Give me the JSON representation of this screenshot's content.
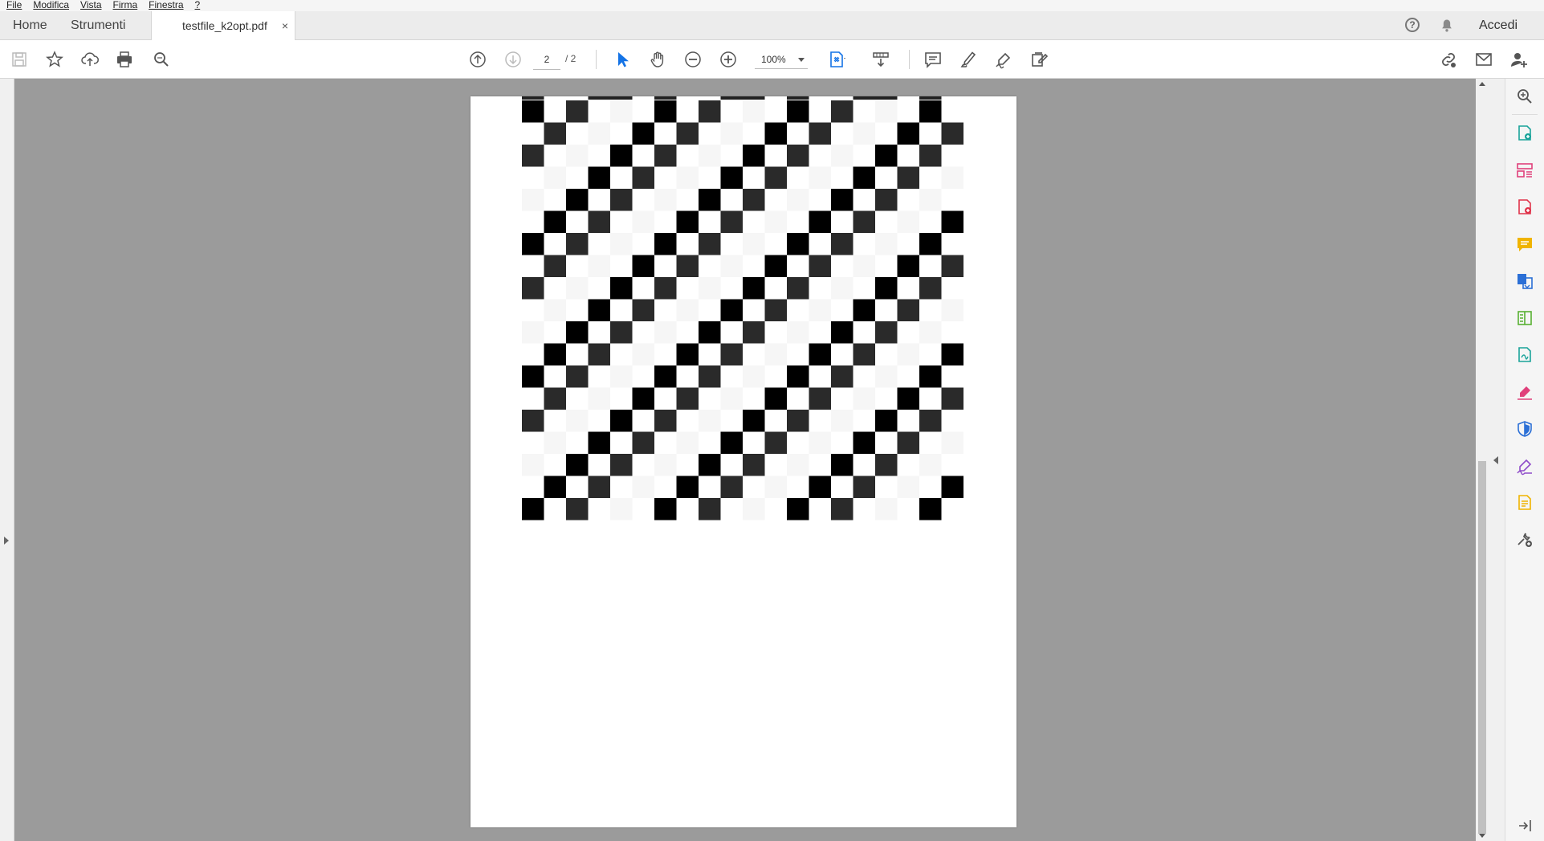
{
  "menu": [
    "File",
    "Modifica",
    "Vista",
    "Firma",
    "Finestra",
    "?"
  ],
  "tabs": {
    "home": "Home",
    "tools": "Strumenti",
    "document": "testfile_k2opt.pdf",
    "close": "×"
  },
  "header": {
    "help": "?",
    "sign_in": "Accedi"
  },
  "toolbar": {
    "page_current": "2",
    "page_total": "/ 2",
    "zoom": "100%"
  },
  "icons": {
    "toolbar_left": [
      "save-icon",
      "bookmark-star-icon",
      "cloud-upload-icon",
      "print-icon",
      "find-icon"
    ],
    "toolbar_center": [
      "page-up-icon",
      "page-down-icon",
      "select-arrow-icon",
      "hand-icon",
      "zoom-out-icon",
      "zoom-in-icon",
      "fit-page-icon",
      "scroll-mode-icon",
      "comment-icon",
      "highlight-icon",
      "sign-icon",
      "edit-icon"
    ],
    "toolbar_right": [
      "share-link-icon",
      "email-icon",
      "add-user-icon"
    ],
    "tools_pane": [
      "zoom-search-icon",
      "create-pdf-icon",
      "organize-pages-icon",
      "export-pdf-icon",
      "comment-icon",
      "combine-files-icon",
      "edit-pdf-icon",
      "send-sign-icon",
      "fill-sign-icon",
      "protect-icon",
      "certificates-icon",
      "send-review-icon",
      "more-tools-icon",
      "collapse-pane-icon"
    ]
  },
  "colors": {
    "accent_blue": "#1473e6",
    "workspace_gray": "#9b9b9b",
    "checker_black": "#000000",
    "checker_dark": "#2a2a2a",
    "checker_light": "#f6f6f6"
  }
}
